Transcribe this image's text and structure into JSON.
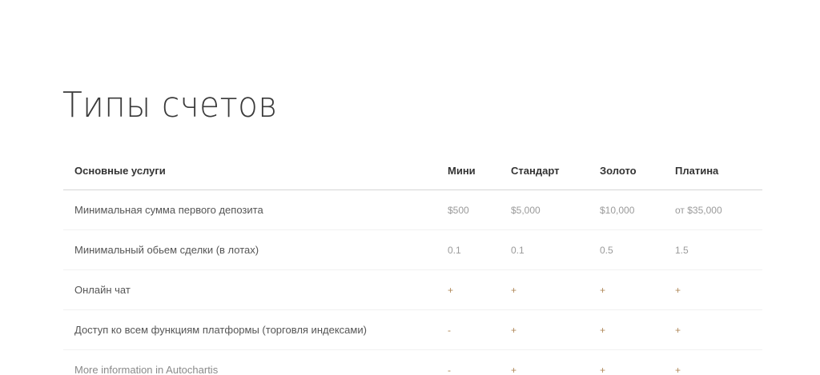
{
  "page": {
    "title": "Типы счетов"
  },
  "table": {
    "headers": [
      "Основные услуги",
      "Мини",
      "Стандарт",
      "Золото",
      "Платина"
    ],
    "rows": [
      {
        "label": "Минимальная сумма первого депозита",
        "values": [
          "$500",
          "$5,000",
          "$10,000",
          "от $35,000"
        ]
      },
      {
        "label": "Минимальный обьем сделки (в лотах)",
        "values": [
          "0.1",
          "0.1",
          "0.5",
          "1.5"
        ]
      },
      {
        "label": "Онлайн чат",
        "values": [
          "+",
          "+",
          "+",
          "+"
        ]
      },
      {
        "label": "Доступ ко всем функциям платформы (торговля индексами)",
        "values": [
          "-",
          "+",
          "+",
          "+"
        ]
      },
      {
        "label": "More information in Autochartis",
        "values": [
          "-",
          "+",
          "+",
          "+"
        ]
      }
    ]
  },
  "colors": {
    "title": "#3a3a3a",
    "header_text": "#333333",
    "row_text": "#555555",
    "value_text": "#9a9a9a",
    "mark_accent": "#b0885a",
    "header_rule": "#d5d5d5",
    "row_rule": "#f1f1f1"
  }
}
